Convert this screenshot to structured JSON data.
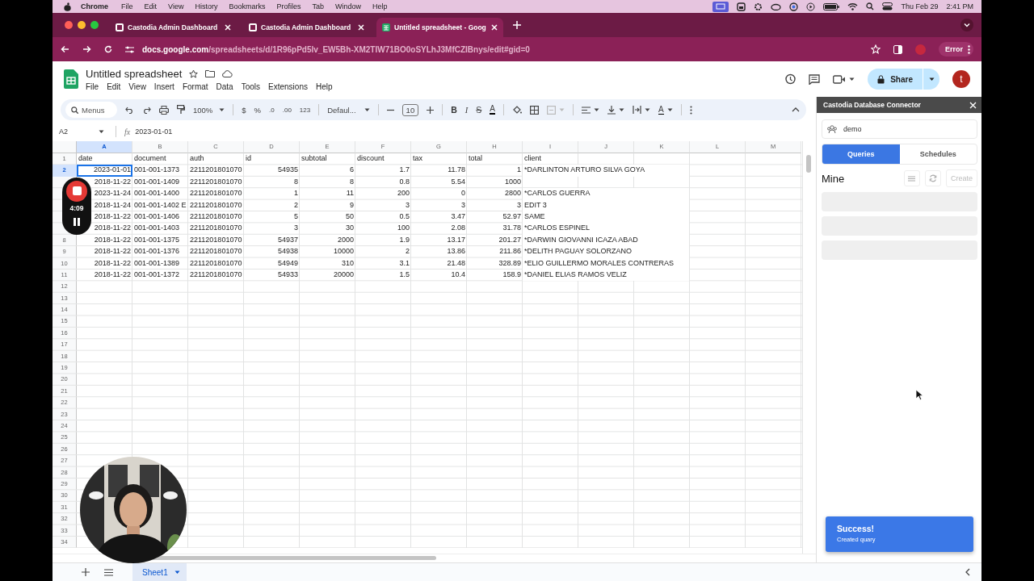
{
  "menubar": {
    "app": "Chrome",
    "menus": [
      "File",
      "Edit",
      "View",
      "History",
      "Bookmarks",
      "Profiles",
      "Tab",
      "Window",
      "Help"
    ],
    "date": "Thu Feb 29",
    "time": "2:41 PM"
  },
  "browser_tabs": [
    {
      "title": "Castodia Admin Dashboard",
      "kind": "page",
      "selected": false
    },
    {
      "title": "Castodia Admin Dashboard",
      "kind": "page",
      "selected": false
    },
    {
      "title": "Untitled spreadsheet - Goog",
      "kind": "sheets",
      "selected": true
    }
  ],
  "address_bar": {
    "host": "docs.google.com",
    "path": "/spreadsheets/d/1R96pPd5lv_EW5Bh-XM2TIW71BO0oSYLhJ3MfCZIBnys/edit#gid=0",
    "profile_button": "Error"
  },
  "document": {
    "title": "Untitled spreadsheet",
    "menus": [
      "File",
      "Edit",
      "View",
      "Insert",
      "Format",
      "Data",
      "Tools",
      "Extensions",
      "Help"
    ],
    "share_button": "Share",
    "avatar": "t"
  },
  "toolbar": {
    "search_placeholder": "Menus",
    "zoom": "100%",
    "currency": "$",
    "percent": "%",
    "decimal_decrease": ".0",
    "decimal_increase": ".00",
    "number_format": "123",
    "font": "Defaul...",
    "font_size": "10",
    "bold": "B",
    "italic": "I",
    "strikethrough": "S",
    "text_color": "A",
    "text_rotation": "A",
    "merge_disabled": true
  },
  "formula_bar": {
    "cell": "A2",
    "fx": "fx",
    "value": "2023-01-01"
  },
  "sheet": {
    "columns": [
      {
        "letter": "A",
        "selected": true
      },
      {
        "letter": "B",
        "selected": false
      },
      {
        "letter": "C",
        "selected": false
      },
      {
        "letter": "D",
        "selected": false
      },
      {
        "letter": "E",
        "selected": false
      },
      {
        "letter": "F",
        "selected": false
      },
      {
        "letter": "G",
        "selected": false
      },
      {
        "letter": "H",
        "selected": false
      },
      {
        "letter": "I",
        "selected": false
      },
      {
        "letter": "J",
        "selected": false
      },
      {
        "letter": "K",
        "selected": false
      },
      {
        "letter": "L",
        "selected": false
      },
      {
        "letter": "M",
        "selected": false
      }
    ],
    "rows": [
      {
        "number": "1",
        "kind": "header",
        "selected": false,
        "cells": [
          "date",
          "document",
          "auth",
          "id",
          "subtotal",
          "discount",
          "tax",
          "total",
          "client"
        ]
      },
      {
        "number": "2",
        "kind": "data",
        "selected": true,
        "cells": [
          "2023-01-01",
          "001-001-1373",
          "2211201801070",
          "54935",
          "6",
          "1.7",
          "11.78",
          "1",
          "*DARLINTON ARTURO SILVA GOYA"
        ]
      },
      {
        "kind": "data",
        "selected": false,
        "cells": [
          "2018-11-22",
          "001-001-1409",
          "2211201801070",
          "8",
          "8",
          "0.8",
          "5.54",
          "1000"
        ]
      },
      {
        "kind": "data",
        "selected": false,
        "cells": [
          "2023-11-24",
          "001-001-1400",
          "2211201801070",
          "1",
          "11",
          "200",
          "0",
          "2800",
          "*CARLOS GUERRA"
        ]
      },
      {
        "kind": "data",
        "selected": false,
        "cells": [
          "2018-11-24",
          "001-001-1402 E",
          "2211201801070",
          "2",
          "9",
          "3",
          "3",
          "3",
          "EDIT 3"
        ]
      },
      {
        "kind": "data",
        "selected": false,
        "cells": [
          "2018-11-22",
          "001-001-1406",
          "2211201801070",
          "5",
          "50",
          "0.5",
          "3.47",
          "52.97",
          "SAME"
        ]
      },
      {
        "kind": "data",
        "selected": false,
        "cells": [
          "2018-11-22",
          "001-001-1403",
          "2211201801070",
          "3",
          "30",
          "100",
          "2.08",
          "31.78",
          "*CARLOS ESPINEL"
        ]
      },
      {
        "number": "8",
        "kind": "data",
        "selected": false,
        "cells": [
          "2018-11-22",
          "001-001-1375",
          "2211201801070",
          "54937",
          "2000",
          "1.9",
          "13.17",
          "201.27",
          "*DARWIN GIOVANNI ICAZA ABAD"
        ]
      },
      {
        "number": "9",
        "kind": "data",
        "selected": false,
        "cells": [
          "2018-11-22",
          "001-001-1376",
          "2211201801070",
          "54938",
          "10000",
          "2",
          "13.86",
          "211.86",
          "*DELITH PAGUAY SOLORZANO"
        ]
      },
      {
        "number": "10",
        "kind": "data",
        "selected": false,
        "cells": [
          "2018-11-22",
          "001-001-1389",
          "2211201801070",
          "54949",
          "310",
          "3.1",
          "21.48",
          "328.89",
          "*ELIO GUILLERMO MORALES CONTRERAS"
        ]
      },
      {
        "number": "11",
        "kind": "data",
        "selected": false,
        "cells": [
          "2018-11-22",
          "001-001-1372",
          "2211201801070",
          "54933",
          "20000",
          "1.5",
          "10.4",
          "158.9",
          "*DANIEL ELIAS RAMOS VELIZ"
        ]
      },
      {
        "number": "12",
        "kind": "empty",
        "selected": false
      },
      {
        "number": "13",
        "kind": "empty",
        "selected": false
      },
      {
        "number": "14",
        "kind": "empty",
        "selected": false
      },
      {
        "number": "15",
        "kind": "empty",
        "selected": false
      },
      {
        "number": "16",
        "kind": "empty",
        "selected": false
      },
      {
        "number": "17",
        "kind": "empty",
        "selected": false
      },
      {
        "number": "18",
        "kind": "empty",
        "selected": false
      },
      {
        "number": "19",
        "kind": "empty",
        "selected": false
      },
      {
        "number": "20",
        "kind": "empty",
        "selected": false
      },
      {
        "number": "21",
        "kind": "empty",
        "selected": false
      },
      {
        "number": "22",
        "kind": "empty",
        "selected": false
      },
      {
        "number": "23",
        "kind": "empty",
        "selected": false
      },
      {
        "number": "24",
        "kind": "empty",
        "selected": false
      },
      {
        "number": "25",
        "kind": "empty",
        "selected": false
      },
      {
        "number": "26",
        "kind": "empty",
        "selected": false
      },
      {
        "number": "27",
        "kind": "empty",
        "selected": false
      },
      {
        "number": "28",
        "kind": "empty",
        "selected": false
      },
      {
        "number": "29",
        "kind": "empty",
        "selected": false
      },
      {
        "number": "30",
        "kind": "empty",
        "selected": false
      },
      {
        "number": "31",
        "kind": "empty",
        "selected": false
      },
      {
        "number": "32",
        "kind": "empty",
        "selected": false
      },
      {
        "number": "33",
        "kind": "empty",
        "selected": false
      },
      {
        "number": "34",
        "kind": "empty",
        "selected": false
      }
    ]
  },
  "recorder": {
    "time": "4:09"
  },
  "side_panel": {
    "title": "Castodia Database Connector",
    "workspace": "demo",
    "tabs": [
      {
        "label": "Queries",
        "selected": true
      },
      {
        "label": "Schedules",
        "selected": false
      }
    ],
    "heading": "Mine",
    "create_button": {
      "label": "Create",
      "disabled": true
    },
    "list_items": [
      {
        "kind": "skeleton"
      },
      {
        "kind": "skeleton"
      },
      {
        "kind": "skeleton"
      }
    ]
  },
  "toast": {
    "title": "Success!",
    "message": "Created quary"
  },
  "sheet_tabs": [
    {
      "label": "Sheet1",
      "selected": true
    }
  ]
}
